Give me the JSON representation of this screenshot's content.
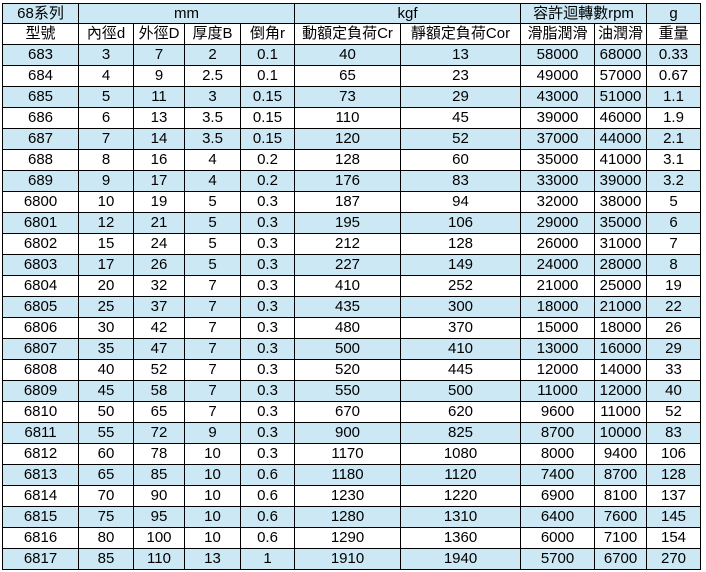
{
  "groups": [
    "68系列",
    "mm",
    "kgf",
    "容許迴轉數rpm",
    "g"
  ],
  "columns": [
    "型號",
    "內徑d",
    "外徑D",
    "厚度B",
    "倒角r",
    "動額定負荷Cr",
    "靜額定負荷Cor",
    "滑脂潤滑",
    "油潤滑",
    "重量"
  ],
  "rows": [
    [
      "683",
      "3",
      "7",
      "2",
      "0.1",
      "40",
      "13",
      "58000",
      "68000",
      "0.33"
    ],
    [
      "684",
      "4",
      "9",
      "2.5",
      "0.1",
      "65",
      "23",
      "49000",
      "57000",
      "0.67"
    ],
    [
      "685",
      "5",
      "11",
      "3",
      "0.15",
      "73",
      "29",
      "43000",
      "51000",
      "1.1"
    ],
    [
      "686",
      "6",
      "13",
      "3.5",
      "0.15",
      "110",
      "45",
      "39000",
      "46000",
      "1.9"
    ],
    [
      "687",
      "7",
      "14",
      "3.5",
      "0.15",
      "120",
      "52",
      "37000",
      "44000",
      "2.1"
    ],
    [
      "688",
      "8",
      "16",
      "4",
      "0.2",
      "128",
      "60",
      "35000",
      "41000",
      "3.1"
    ],
    [
      "689",
      "9",
      "17",
      "4",
      "0.2",
      "176",
      "83",
      "33000",
      "39000",
      "3.2"
    ],
    [
      "6800",
      "10",
      "19",
      "5",
      "0.3",
      "187",
      "94",
      "32000",
      "38000",
      "5"
    ],
    [
      "6801",
      "12",
      "21",
      "5",
      "0.3",
      "195",
      "106",
      "29000",
      "35000",
      "6"
    ],
    [
      "6802",
      "15",
      "24",
      "5",
      "0.3",
      "212",
      "128",
      "26000",
      "31000",
      "7"
    ],
    [
      "6803",
      "17",
      "26",
      "5",
      "0.3",
      "227",
      "149",
      "24000",
      "28000",
      "8"
    ],
    [
      "6804",
      "20",
      "32",
      "7",
      "0.3",
      "410",
      "252",
      "21000",
      "25000",
      "19"
    ],
    [
      "6805",
      "25",
      "37",
      "7",
      "0.3",
      "435",
      "300",
      "18000",
      "21000",
      "22"
    ],
    [
      "6806",
      "30",
      "42",
      "7",
      "0.3",
      "480",
      "370",
      "15000",
      "18000",
      "26"
    ],
    [
      "6807",
      "35",
      "47",
      "7",
      "0.3",
      "500",
      "410",
      "13000",
      "16000",
      "29"
    ],
    [
      "6808",
      "40",
      "52",
      "7",
      "0.3",
      "520",
      "445",
      "12000",
      "14000",
      "33"
    ],
    [
      "6809",
      "45",
      "58",
      "7",
      "0.3",
      "550",
      "500",
      "11000",
      "12000",
      "40"
    ],
    [
      "6810",
      "50",
      "65",
      "7",
      "0.3",
      "670",
      "620",
      "9600",
      "11000",
      "52"
    ],
    [
      "6811",
      "55",
      "72",
      "9",
      "0.3",
      "900",
      "825",
      "8700",
      "10000",
      "83"
    ],
    [
      "6812",
      "60",
      "78",
      "10",
      "0.3",
      "1170",
      "1080",
      "8000",
      "9400",
      "106"
    ],
    [
      "6813",
      "65",
      "85",
      "10",
      "0.6",
      "1180",
      "1120",
      "7400",
      "8700",
      "128"
    ],
    [
      "6814",
      "70",
      "90",
      "10",
      "0.6",
      "1230",
      "1220",
      "6900",
      "8100",
      "137"
    ],
    [
      "6815",
      "75",
      "95",
      "10",
      "0.6",
      "1280",
      "1310",
      "6400",
      "7600",
      "145"
    ],
    [
      "6816",
      "80",
      "100",
      "10",
      "0.6",
      "1290",
      "1360",
      "6000",
      "7100",
      "154"
    ],
    [
      "6817",
      "85",
      "110",
      "13",
      "1",
      "1910",
      "1940",
      "5700",
      "6700",
      "270"
    ]
  ]
}
